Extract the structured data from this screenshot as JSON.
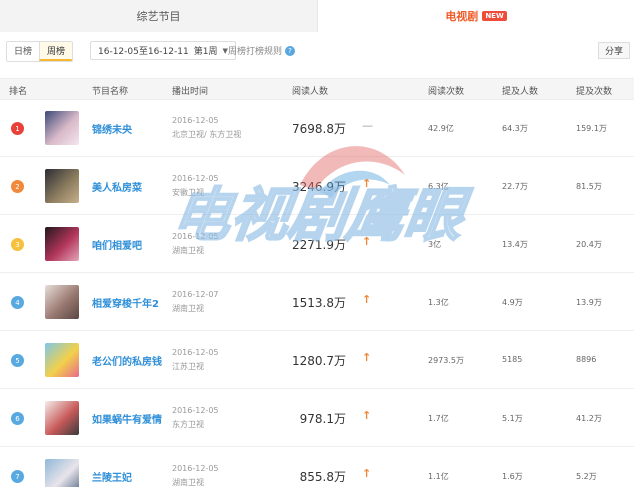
{
  "tabs": {
    "variety": "综艺节目",
    "tv": "电视剧",
    "new_badge": "NEW"
  },
  "filters": {
    "daily": "日榜",
    "weekly": "周榜",
    "range": "16-12-05至16-12-11  ",
    "week": "第1周",
    "rules": "周榜打榜规则",
    "share": "分享"
  },
  "columns": {
    "rank": "排名",
    "name": "节目名称",
    "airtime": "播出时间",
    "readers": "阅读人数",
    "reads": "阅读次数",
    "mention_people": "提及人数",
    "mention_times": "提及次数"
  },
  "rows": [
    {
      "rank": "1",
      "rank_color": "#e8413a",
      "title": "锦绣未央",
      "date": "2016-12-05",
      "channel": "北京卫视/ 东方卫视",
      "readers": "7698.8万",
      "trend": "—",
      "trend_type": "flat",
      "reads": "42.9亿",
      "people": "64.3万",
      "times": "159.1万",
      "poster": [
        "#3b4a7a",
        "#d9b9c8",
        "#f3e6ee"
      ]
    },
    {
      "rank": "2",
      "rank_color": "#f08a3a",
      "title": "美人私房菜",
      "date": "2016-12-05",
      "channel": "安徽卫视",
      "readers": "3246.9万",
      "trend": "↑",
      "trend_type": "up",
      "reads": "6.3亿",
      "people": "22.7万",
      "times": "81.5万",
      "poster": [
        "#2c2c34",
        "#8a7b5e",
        "#c8b08a"
      ]
    },
    {
      "rank": "3",
      "rank_color": "#f5c13c",
      "title": "咱们相爱吧",
      "date": "2016-12-05",
      "channel": "湖南卫视",
      "readers": "2271.9万",
      "trend": "↑",
      "trend_type": "up",
      "reads": "3亿",
      "people": "13.4万",
      "times": "20.4万",
      "poster": [
        "#23161e",
        "#b2365b",
        "#e4a6b8"
      ]
    },
    {
      "rank": "4",
      "rank_color": "#58a9e0",
      "title": "相爱穿梭千年2",
      "date": "2016-12-07",
      "channel": "湖南卫视",
      "readers": "1513.8万",
      "trend": "↑",
      "trend_type": "up",
      "reads": "1.3亿",
      "people": "4.9万",
      "times": "13.9万",
      "poster": [
        "#e8ded8",
        "#9a7a72",
        "#5a4642"
      ]
    },
    {
      "rank": "5",
      "rank_color": "#58a9e0",
      "title": "老公们的私房钱",
      "date": "2016-12-05",
      "channel": "江苏卫视",
      "readers": "1280.7万",
      "trend": "↑",
      "trend_type": "up",
      "reads": "2973.5万",
      "people": "5185",
      "times": "8896",
      "poster": [
        "#7fc7e8",
        "#f2d04a",
        "#e86a8a"
      ]
    },
    {
      "rank": "6",
      "rank_color": "#58a9e0",
      "title": "如果蜗牛有爱情",
      "date": "2016-12-05",
      "channel": "东方卫视",
      "readers": "978.1万",
      "trend": "↑",
      "trend_type": "up",
      "reads": "1.7亿",
      "people": "5.1万",
      "times": "41.2万",
      "poster": [
        "#f4eeea",
        "#c85a5a",
        "#3a3a3a"
      ]
    },
    {
      "rank": "7",
      "rank_color": "#58a9e0",
      "title": "兰陵王妃",
      "date": "2016-12-05",
      "channel": "湖南卫视",
      "readers": "855.8万",
      "trend": "↑",
      "trend_type": "up",
      "reads": "1.1亿",
      "people": "1.6万",
      "times": "5.2万",
      "poster": [
        "#8fb8d8",
        "#e8e4ea",
        "#5a6e8a"
      ]
    }
  ],
  "watermark": "电视剧鹰眼"
}
